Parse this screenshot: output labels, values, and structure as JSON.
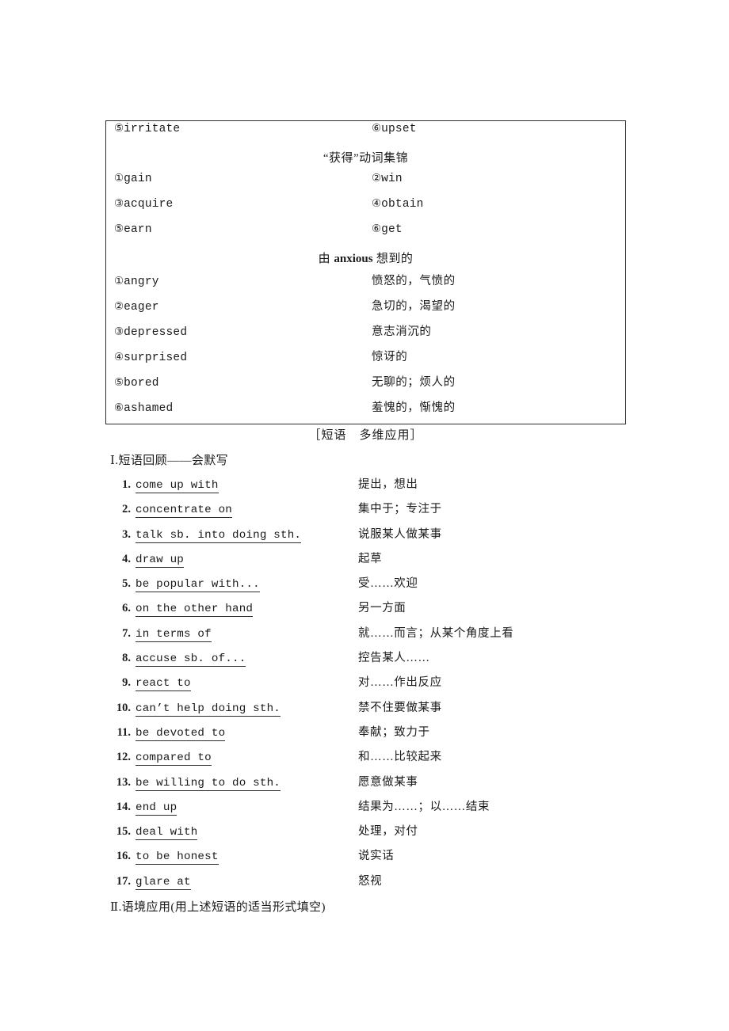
{
  "vocab_box": {
    "rows": [
      {
        "type": "pair",
        "left": {
          "marker": "⑤",
          "word": "irritate"
        },
        "right": {
          "marker": "⑥",
          "word": "upset"
        }
      },
      {
        "type": "heading",
        "text": "“获得”动词集锦"
      },
      {
        "type": "pair",
        "left": {
          "marker": "①",
          "word": "gain"
        },
        "right": {
          "marker": "②",
          "word": "win"
        }
      },
      {
        "type": "pair",
        "left": {
          "marker": "③",
          "word": "acquire"
        },
        "right": {
          "marker": "④",
          "word": "obtain"
        }
      },
      {
        "type": "pair",
        "left": {
          "marker": "⑤",
          "word": "earn"
        },
        "right": {
          "marker": "⑥",
          "word": "get"
        }
      },
      {
        "type": "heading_mixed",
        "prefix": "由 ",
        "emphasis": "anxious",
        "suffix": " 想到的"
      },
      {
        "type": "gloss",
        "left": {
          "marker": "①",
          "word": "angry"
        },
        "meaning": "愤怒的，气愤的"
      },
      {
        "type": "gloss",
        "left": {
          "marker": "②",
          "word": "eager"
        },
        "meaning": "急切的，渴望的"
      },
      {
        "type": "gloss",
        "left": {
          "marker": "③",
          "word": "depressed"
        },
        "meaning": "意志消沉的"
      },
      {
        "type": "gloss",
        "left": {
          "marker": "④",
          "word": "surprised"
        },
        "meaning": "惊讶的"
      },
      {
        "type": "gloss",
        "left": {
          "marker": "⑤",
          "word": "bored"
        },
        "meaning": "无聊的；烦人的"
      },
      {
        "type": "gloss",
        "left": {
          "marker": "⑥",
          "word": "ashamed"
        },
        "meaning": "羞愧的，惭愧的"
      }
    ]
  },
  "bracket_heading": "［短语　多维应用］",
  "section_one_heading": "Ⅰ.短语回顾——会默写",
  "section_two_heading": "Ⅱ.语境应用(用上述短语的适当形式填空)",
  "phrases": [
    {
      "num": "1.",
      "term": "come up with",
      "meaning": "提出，想出"
    },
    {
      "num": "2.",
      "term": "concentrate on",
      "meaning": "集中于；专注于"
    },
    {
      "num": "3.",
      "term": "talk sb. into doing sth.",
      "meaning": "说服某人做某事"
    },
    {
      "num": "4.",
      "term": "draw up",
      "meaning": "起草"
    },
    {
      "num": "5.",
      "term": "be popular with...",
      "meaning": "受……欢迎"
    },
    {
      "num": "6.",
      "term": "on the other hand",
      "meaning": "另一方面"
    },
    {
      "num": "7.",
      "term": "in terms of",
      "meaning": "就……而言；从某个角度上看"
    },
    {
      "num": "8.",
      "term": "accuse sb. of...",
      "meaning": "控告某人……"
    },
    {
      "num": "9.",
      "term": "react to",
      "meaning": "对……作出反应"
    },
    {
      "num": "10.",
      "term": "can’t help doing sth.",
      "meaning": "禁不住要做某事"
    },
    {
      "num": "11.",
      "term": "be devoted to",
      "meaning": "奉献；致力于"
    },
    {
      "num": "12.",
      "term": "compared to",
      "meaning": "和……比较起来"
    },
    {
      "num": "13.",
      "term": "be willing to do sth.",
      "meaning": "愿意做某事"
    },
    {
      "num": "14.",
      "term": "end up",
      "meaning": "结果为……；以……结束"
    },
    {
      "num": "15.",
      "term": "deal with",
      "meaning": "处理，对付"
    },
    {
      "num": "16.",
      "term": "to be honest",
      "meaning": "说实话"
    },
    {
      "num": "17.",
      "term": "glare at",
      "meaning": "怒视"
    }
  ]
}
